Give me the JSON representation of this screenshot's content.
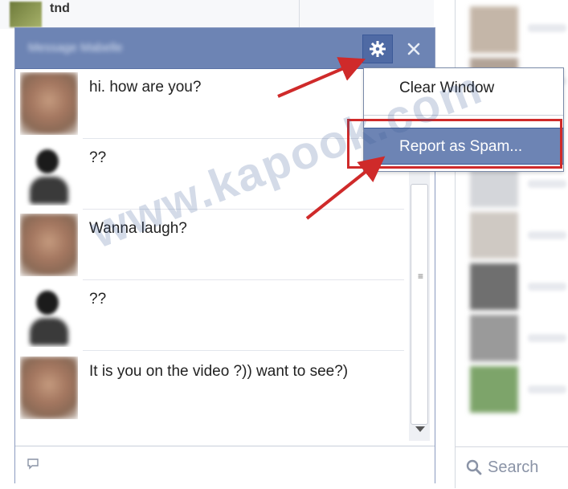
{
  "background": {
    "top_text": "tnd"
  },
  "chat": {
    "contact_name": "Message Mabelle",
    "messages": [
      {
        "avatar": "woman",
        "text": "hi. how are you?"
      },
      {
        "avatar": "silhouette",
        "text": "??"
      },
      {
        "avatar": "woman",
        "text": "Wanna laugh?"
      },
      {
        "avatar": "silhouette",
        "text": "??"
      },
      {
        "avatar": "woman",
        "text": "It is you on the video ?)) want to see?)"
      }
    ],
    "scroll_grip": "≡"
  },
  "menu": {
    "clear_window": "Clear Window",
    "report_spam": "Report as Spam..."
  },
  "sidebar": {
    "search_label": "Search"
  },
  "watermark": "www.kapook.com",
  "colors": {
    "header_blue": "#6d84b4",
    "annotation_red": "#cf2a2a"
  },
  "icons": {
    "settings": "gear-icon",
    "close": "close-icon",
    "input": "chat-bubble-icon",
    "search": "search-icon"
  }
}
